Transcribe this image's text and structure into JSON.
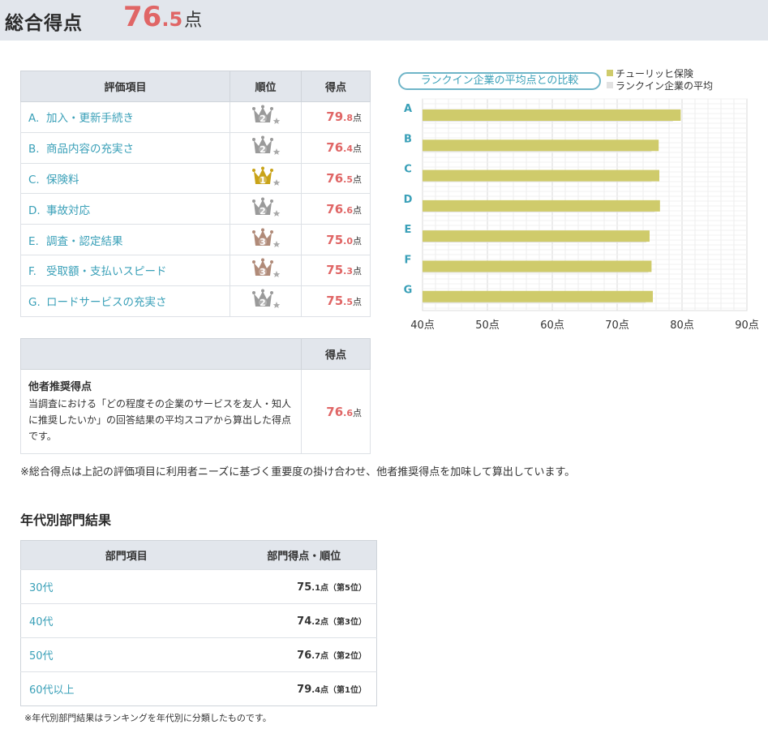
{
  "header": {
    "title": "総合得点",
    "score_int": "76",
    "score_dec": ".5",
    "score_unit": "点"
  },
  "eval_table": {
    "headers": [
      "評価項目",
      "順位",
      "得点"
    ],
    "rows": [
      {
        "letter": "A.",
        "label": "加入・更新手続き",
        "rank": 2,
        "rank_color": "silver",
        "int": "79",
        "dec": ".8",
        "unit": "点"
      },
      {
        "letter": "B.",
        "label": "商品内容の充実さ",
        "rank": 2,
        "rank_color": "silver",
        "int": "76",
        "dec": ".4",
        "unit": "点"
      },
      {
        "letter": "C.",
        "label": "保険料",
        "rank": 1,
        "rank_color": "gold",
        "int": "76",
        "dec": ".5",
        "unit": "点"
      },
      {
        "letter": "D.",
        "label": "事故対応",
        "rank": 2,
        "rank_color": "silver",
        "int": "76",
        "dec": ".6",
        "unit": "点"
      },
      {
        "letter": "E.",
        "label": "調査・認定結果",
        "rank": 3,
        "rank_color": "bronze",
        "int": "75",
        "dec": ".0",
        "unit": "点"
      },
      {
        "letter": "F.",
        "label": "受取額・支払いスピード",
        "rank": 3,
        "rank_color": "bronze",
        "int": "75",
        "dec": ".3",
        "unit": "点"
      },
      {
        "letter": "G.",
        "label": "ロードサービスの充実さ",
        "rank": 2,
        "rank_color": "silver",
        "int": "75",
        "dec": ".5",
        "unit": "点"
      }
    ]
  },
  "recommend": {
    "header": "得点",
    "title": "他者推奨得点",
    "description": "当調査における「どの程度その企業のサービスを友人・知人に推奨したいか」の回答結果の平均スコアから算出した得点です。",
    "int": "76",
    "dec": ".6",
    "unit": "点"
  },
  "note1": "※総合得点は上記の評価項目に利用者ニーズに基づく重要度の掛け合わせ、他者推奨得点を加味して算出しています。",
  "age_section": {
    "title": "年代別部門結果",
    "headers": [
      "部門項目",
      "部門得点・順位"
    ],
    "rows": [
      {
        "label": "30代",
        "int": "75",
        "dec": ".1",
        "unit": "点",
        "rank": "（第5位）"
      },
      {
        "label": "40代",
        "int": "74",
        "dec": ".2",
        "unit": "点",
        "rank": "（第3位）"
      },
      {
        "label": "50代",
        "int": "76",
        "dec": ".7",
        "unit": "点",
        "rank": "（第2位）"
      },
      {
        "label": "60代以上",
        "int": "79",
        "dec": ".4",
        "unit": "点",
        "rank": "（第1位）"
      }
    ],
    "note": "※年代別部門結果はランキングを年代別に分類したものです。"
  },
  "chart_pill": "ランクイン企業の平均点との比較",
  "colors": {
    "accent_red": "#e06666",
    "link_teal": "#3aa0b8",
    "bar_company": "#cfcb6b",
    "bar_average": "#e2e2e2",
    "gold": "#c9a318",
    "silver": "#9a9a9a",
    "bronze": "#b08a78"
  },
  "chart_data": {
    "type": "bar",
    "orientation": "horizontal",
    "categories": [
      "A",
      "B",
      "C",
      "D",
      "E",
      "F",
      "G"
    ],
    "series": [
      {
        "name": "チューリッヒ保険",
        "values": [
          79.8,
          76.4,
          76.5,
          76.6,
          75.0,
          75.3,
          75.5
        ]
      },
      {
        "name": "ランクイン企業の平均",
        "values": [
          78.6,
          75.3,
          75.3,
          75.8,
          74.5,
          74.8,
          74.4
        ]
      }
    ],
    "xlim": [
      40,
      90
    ],
    "ticks": [
      40,
      50,
      60,
      70,
      80,
      90
    ],
    "tick_suffix": "点",
    "legend_position": "top-right",
    "grid": true
  }
}
